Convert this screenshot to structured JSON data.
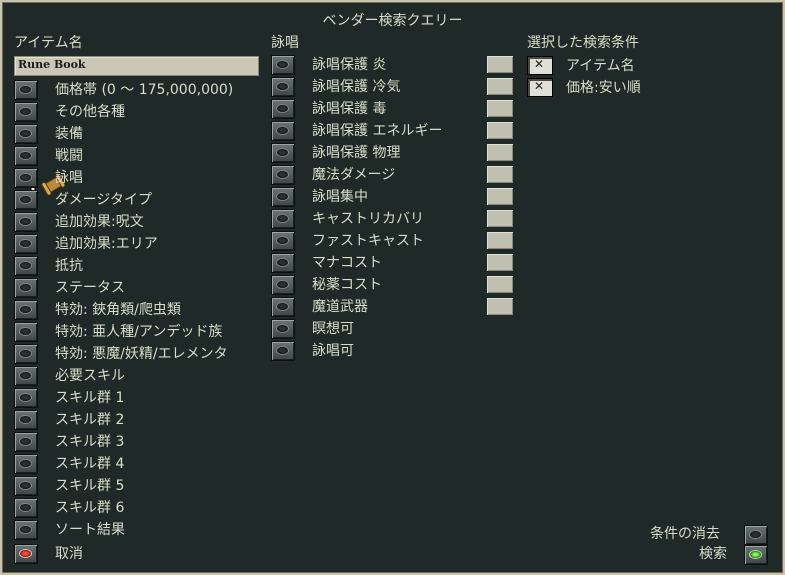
{
  "title": "ベンダー検索クエリー",
  "headers": {
    "item_name": "アイテム名",
    "chant": "詠唱",
    "selected": "選択した検索条件"
  },
  "name_input_value": "Rune Book",
  "left_items": [
    "価格帯 (0 〜 175,000,000)",
    "その他各種",
    "装備",
    "戦闘",
    "詠唱",
    "ダメージタイプ",
    "追加効果:呪文",
    "追加効果:エリア",
    "抵抗",
    "ステータス",
    "特効: 鋏角類/爬虫類",
    "特効: 亜人種/アンデッド族",
    "特効: 悪魔/妖精/エレメンタ",
    "必要スキル",
    "スキル群 1",
    "スキル群 2",
    "スキル群 3",
    "スキル群 4",
    "スキル群 5",
    "スキル群 6",
    "ソート結果"
  ],
  "cancel_label": "取消",
  "middle_items": [
    "詠唱保護 炎",
    "詠唱保護 冷気",
    "詠唱保護 毒",
    "詠唱保護 エネルギー",
    "詠唱保護 物理",
    "魔法ダメージ",
    "詠唱集中",
    "キャストリカバリ",
    "ファストキャスト",
    "マナコスト",
    "秘薬コスト",
    "魔道武器",
    "瞑想可",
    "詠唱可"
  ],
  "selected_conditions": [
    "アイテム名",
    "価格:安い順"
  ],
  "clear_label": "条件の消去",
  "search_label": "検索"
}
